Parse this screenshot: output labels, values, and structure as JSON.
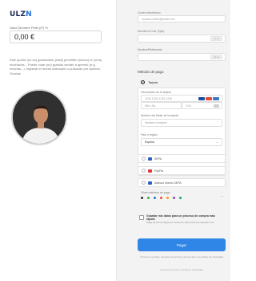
{
  "brand": {
    "name_dark": "ULZ",
    "name_accent": "N"
  },
  "amount": {
    "label": "Valor (Nombre Pétel (IF) %",
    "value": "0,00 €"
  },
  "description": "Este aporte (no es) gestionable (está) permitido (hecho) en (una) muchacha... Puede votar (no) gratuito vender a aprendí (e.g. muchas...). Ingresar el monto adecuado o pulsando por aportes, Gracias",
  "right_fields": [
    {
      "label": "Correo electrónico",
      "value": "usuario.recibo@email.com",
      "has_button": false
    },
    {
      "label": "Escribe el Cód. (Opc)",
      "value": "",
      "has_button": true,
      "button": "Aplicar"
    },
    {
      "label": "Nombre/Referencia",
      "value": "",
      "has_button": true,
      "button": "Aplicar"
    }
  ],
  "payment": {
    "title": "Método de pago",
    "card_option": "Tarjeta",
    "card_number_label": "Información de la tarjeta",
    "card_number_placeholder": "1234 1234 1234 1234",
    "expiry_placeholder": "MM / AA",
    "cvc_placeholder": "CVC",
    "holder_label": "Nombre del titular de la tarjeta",
    "holder_placeholder": "Nombre completo",
    "country_label": "País o región",
    "country_value": "España",
    "options": [
      "SEPA",
      "PayPal",
      "Adeudo directo SEPA"
    ],
    "other_label": "Otros métodos de pago"
  },
  "save": {
    "title": "Guardar mis datos para un proceso de compra más rápido",
    "subtitle": "Paga de forma segura en todos los sitios web que aceptan Link"
  },
  "pay_button": "Pagar",
  "fine_print": "Al hacer tu pedido, aceptas los términos del servicio y la política de privacidad",
  "footer": "Powered by stripe  |  Términos  Privacidad",
  "colors": {
    "accent": "#2f86e6",
    "brand_dark": "#1c2a55"
  }
}
